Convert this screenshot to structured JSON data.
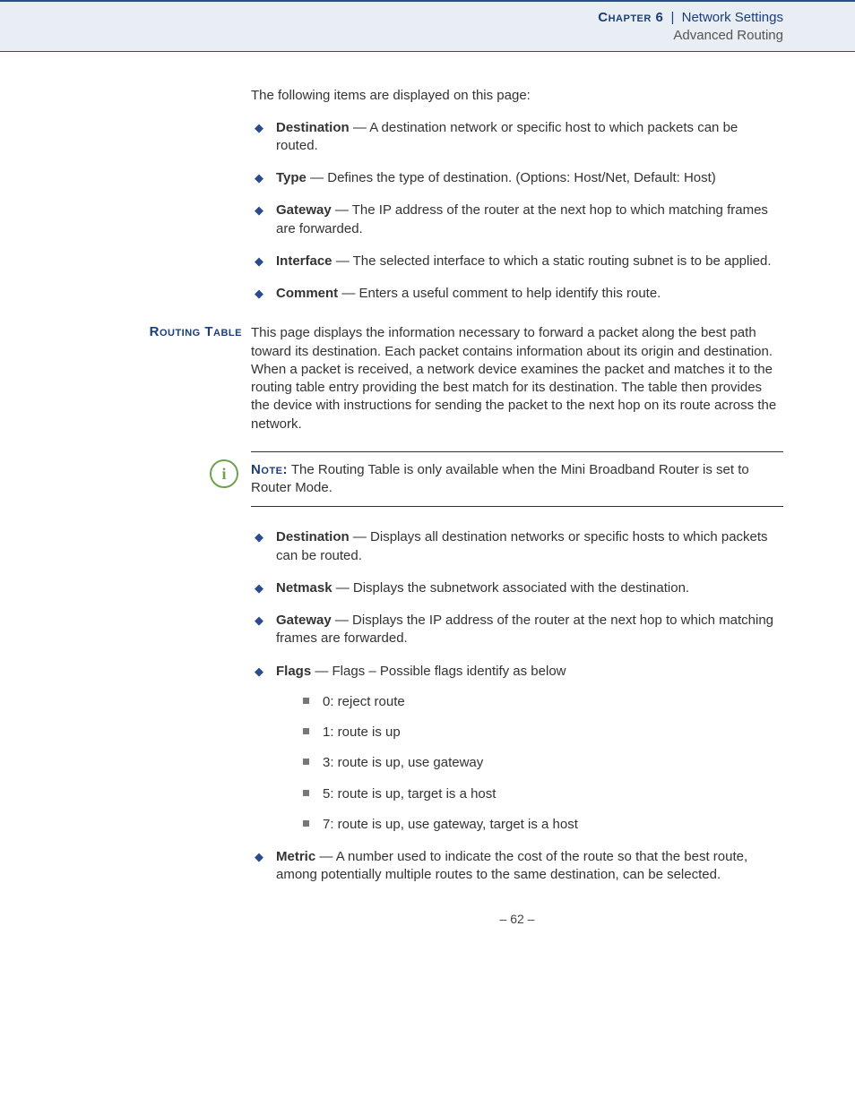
{
  "header": {
    "chapter": "Chapter 6",
    "separator": "|",
    "title": "Network Settings",
    "subtitle": "Advanced Routing"
  },
  "intro": "The following items are displayed on this page:",
  "items1": [
    {
      "term": "Destination",
      "desc": " — A destination network or specific host to which packets can be routed."
    },
    {
      "term": "Type",
      "desc": " — Defines the type of destination. (Options: Host/Net, Default: Host)"
    },
    {
      "term": "Gateway",
      "desc": " — The IP address of the router at the next hop to which matching frames are forwarded."
    },
    {
      "term": "Interface",
      "desc": " — The selected interface to which a static routing subnet is to be applied."
    },
    {
      "term": "Comment",
      "desc": " — Enters a useful comment to help identify this route."
    }
  ],
  "section": {
    "label": "Routing Table",
    "para": "This page displays the information necessary to forward a packet along the best path toward its destination. Each packet contains information about its origin and destination. When a packet is received, a network device examines the packet and matches it to the routing table entry providing the best match for its destination. The table then provides the device with instructions for sending the packet to the next hop on its route across the network."
  },
  "note": {
    "icon": "i",
    "label": "Note:",
    "text": " The Routing Table is only available when the Mini Broadband Router is set to Router Mode."
  },
  "items2": [
    {
      "term": "Destination",
      "desc": " — Displays all destination networks or specific hosts to which packets can be routed."
    },
    {
      "term": "Netmask",
      "desc": " — Displays the subnetwork associated with the destination."
    },
    {
      "term": "Gateway",
      "desc": " — Displays the IP address of the router at the next hop to which matching frames are forwarded."
    },
    {
      "term": "Flags",
      "desc": " — Flags – Possible flags identify as below",
      "sub": [
        "0: reject route",
        "1: route is up",
        "3: route is up, use gateway",
        "5: route is up, target is a host",
        "7: route is up, use gateway, target is a host"
      ]
    },
    {
      "term": "Metric",
      "desc": " — A number used to indicate the cost of the route so that the best route, among potentially multiple routes to the same destination, can be selected."
    }
  ],
  "footer": "–  62  –"
}
